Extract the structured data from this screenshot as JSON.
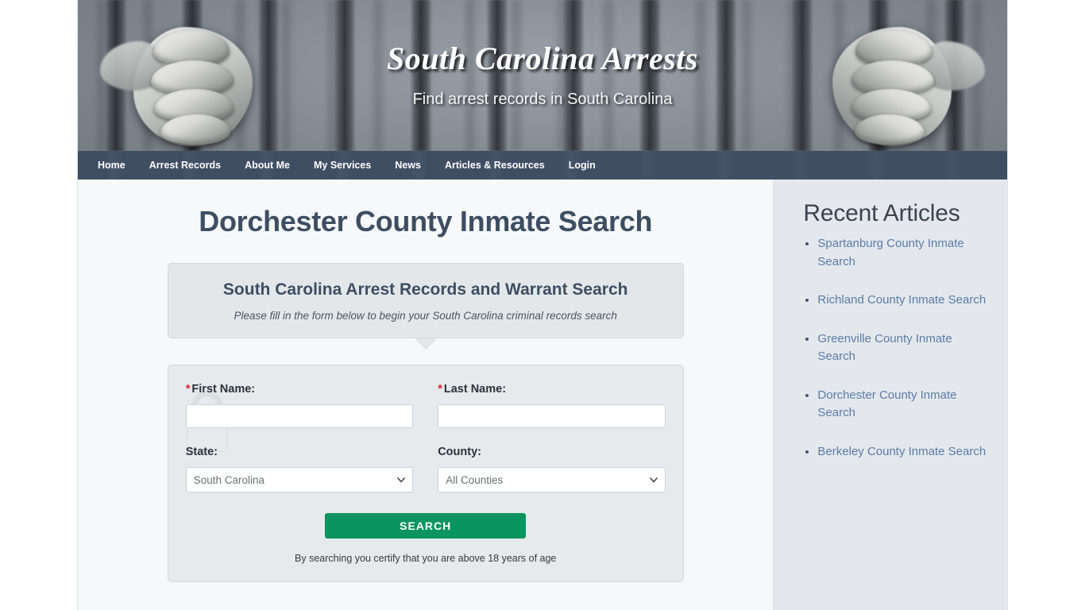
{
  "banner": {
    "title": "South Carolina Arrests",
    "tagline": "Find arrest records in South Carolina",
    "left_image_alt": "hands-gripping-jail-bars",
    "right_image_alt": "hands-gripping-jail-bars-mirrored"
  },
  "nav": {
    "items": [
      {
        "label": "Home"
      },
      {
        "label": "Arrest Records"
      },
      {
        "label": "About Me"
      },
      {
        "label": "My Services"
      },
      {
        "label": "News"
      },
      {
        "label": "Articles & Resources"
      },
      {
        "label": "Login"
      }
    ]
  },
  "main": {
    "page_title": "Dorchester County Inmate Search",
    "callout": {
      "title": "South Carolina Arrest Records and Warrant Search",
      "subtitle": "Please fill in the form below to begin your South Carolina criminal records search"
    },
    "form": {
      "first_name": {
        "required_marker": "*",
        "label": "First Name:",
        "value": "",
        "placeholder": ""
      },
      "last_name": {
        "required_marker": "*",
        "label": "Last Name:",
        "value": "",
        "placeholder": ""
      },
      "state": {
        "label": "State:",
        "selected": "South Carolina",
        "options": [
          "South Carolina"
        ]
      },
      "county": {
        "label": "County:",
        "selected": "All Counties",
        "options": [
          "All Counties"
        ]
      },
      "search_button": "SEARCH",
      "certify_text": "By searching you certify that you are above 18 years of age"
    }
  },
  "sidebar": {
    "title": "Recent Articles",
    "links": [
      {
        "label": "Spartanburg County Inmate Search"
      },
      {
        "label": "Richland County Inmate Search"
      },
      {
        "label": "Greenville County Inmate Search"
      },
      {
        "label": "Dorchester County Inmate Search"
      },
      {
        "label": "Berkeley County Inmate Search"
      }
    ]
  },
  "colors": {
    "nav_background": "#3f4e63",
    "heading": "#3d4e63",
    "search_button": "#0a9460",
    "link": "#5b7ba6",
    "required_marker": "#e0202e",
    "sidebar_background": "#e4e8ed",
    "content_background": "#f7f8f9"
  }
}
